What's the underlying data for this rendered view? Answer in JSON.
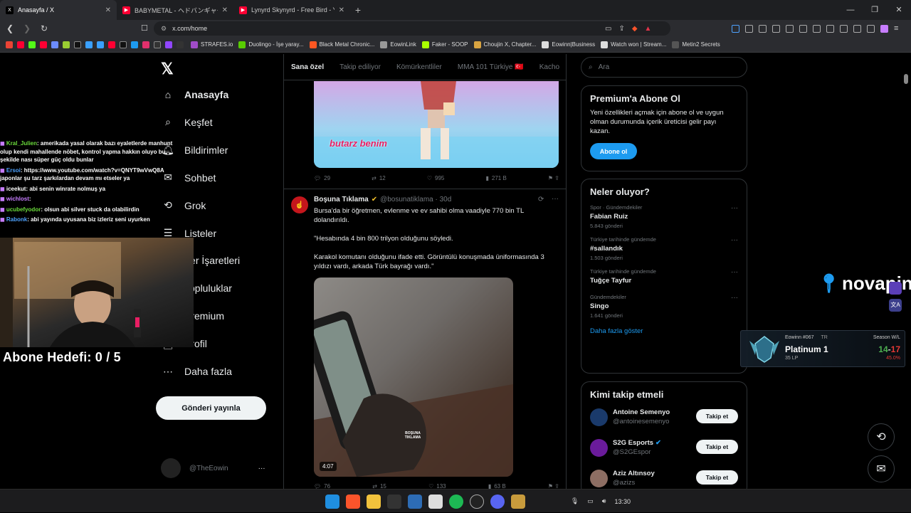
{
  "browser": {
    "tabs": [
      {
        "title": "Anasayfa / X",
        "fav": "X",
        "color": "#000000",
        "active": true
      },
      {
        "title": "BABYMETAL - ヘドバンギャー！！ 15th",
        "fav": "▶",
        "color": "#ff0033",
        "active": false
      },
      {
        "title": "Lynyrd Skynyrd - Free Bird - YouT",
        "fav": "▶",
        "color": "#ff0033",
        "active": false
      }
    ],
    "url": "x.com/home",
    "bookmarks": [
      {
        "label": "STRAFES.io",
        "color": "#a04cc8"
      },
      {
        "label": "Duolingo - İşe yaray...",
        "color": "#58cc02"
      },
      {
        "label": "Black Metal Chronic...",
        "color": "#ff5722"
      },
      {
        "label": "EowinLink",
        "color": "#999999"
      },
      {
        "label": "Faker - SOOP",
        "color": "#aaff00"
      },
      {
        "label": "Choujin X, Chapter...",
        "color": "#d9a441"
      },
      {
        "label": "Eowinn|Business",
        "color": "#dddddd"
      },
      {
        "label": "Watch won | Stream...",
        "color": "#dddddd"
      },
      {
        "label": "Metin2 Secrets",
        "color": "#555555"
      }
    ]
  },
  "nav": {
    "items": [
      {
        "label": "Anasayfa",
        "icon": "home-icon",
        "bold": true
      },
      {
        "label": "Keşfet",
        "icon": "search-icon"
      },
      {
        "label": "Bildirimler",
        "icon": "bell-icon"
      },
      {
        "label": "Sohbet",
        "icon": "mail-icon"
      },
      {
        "label": "Grok",
        "icon": "grok-icon"
      },
      {
        "label": "Listeler",
        "icon": "list-icon"
      },
      {
        "label": "Yer İşaretleri",
        "icon": "bookmark-icon"
      },
      {
        "label": "Topluluklar",
        "icon": "people-icon"
      },
      {
        "label": "Premium",
        "icon": "x-icon"
      },
      {
        "label": "Profil",
        "icon": "user-icon"
      },
      {
        "label": "Daha fazla",
        "icon": "more-icon"
      }
    ],
    "post_label": "Gönderi yayınla",
    "account_handle": "@TheEowin"
  },
  "overlay": {
    "chat": [
      {
        "user": "Kral_Julien",
        "color": "#6bdc3b",
        "text": ": amerikada yasal olarak bazı eyaletlerde manhunt olup kendi mahallende nöbet, kontrol yapma hakkın oluyo bu şekilde nası süper güç oldu bunlar"
      },
      {
        "user": "Ersoi",
        "color": "#4fa3ff",
        "text": ": https://www.youtube.com/watch?v=QNYT9wVwQ8A japonlar şu tarz şarkılardan devam mı etseler ya"
      },
      {
        "user": "iceekut",
        "color": "#ffffff",
        "text": ": abi senin winrate nolmuş ya"
      },
      {
        "user": "wichlost",
        "color": "#c77dff",
        "text": ":"
      },
      {
        "user": "ucubefyodor",
        "color": "#6bdc3b",
        "text": ": olsun abi silver stuck da olabilirdin"
      },
      {
        "user": "Rabonk",
        "color": "#4fa3ff",
        "text": ": abi yayında uyusana biz izleriz seni uyurken"
      }
    ],
    "goal": "Abone Hedefi:  0 / 5",
    "brand": "novapin"
  },
  "timeline": {
    "tabs": [
      "Sana özel",
      "Takip ediliyor",
      "Kömürkentliler",
      "MMA 101 Türkiye 🇹🇷",
      "Kacho"
    ],
    "tweet1_actions": {
      "replies": "29",
      "reposts": "12",
      "likes": "995",
      "views": "271 B"
    },
    "media1_caption": "butarz benim",
    "tweet2": {
      "name": "Boşuna Tıklama",
      "handle": "@bosunatiklama · 30d",
      "text1": "Bursa'da bir öğretmen, evlenme ve ev sahibi olma vaadiyle 770 bin TL dolandırıldı.",
      "text2": "\"Hesabında 4 bin 800 trilyon olduğunu söyledi.",
      "text3": "Karakol komutanı olduğunu ifade etti. Görüntülü konuşmada üniformasında 3 yıldızı vardı, arkada Türk bayrağı vardı.\"",
      "duration": "4:07",
      "watermark": "BOŞUNA TIKLAMA",
      "actions": {
        "replies": "76",
        "reposts": "15",
        "likes": "133",
        "views": "63 B"
      }
    }
  },
  "sidebar": {
    "search_placeholder": "Ara",
    "premium": {
      "title": "Premium'a Abone Ol",
      "text": "Yeni özellikleri açmak için abone ol ve uygun olman durumunda içerik üreticisi gelir payı kazan.",
      "button": "Abone ol"
    },
    "trends_title": "Neler oluyor?",
    "trends": [
      {
        "category": "Spor · Gündemdekiler",
        "name": "Fabian Ruiz",
        "posts": "5.843 gönderi"
      },
      {
        "category": "Türkiye tarihinde gündemde",
        "name": "#sallandık",
        "posts": "1.503 gönderi"
      },
      {
        "category": "Türkiye tarihinde gündemde",
        "name": "Tuğçe Tayfur",
        "posts": ""
      },
      {
        "category": "Gündemdekiler",
        "name": "Singo",
        "posts": "1.641 gönderi"
      }
    ],
    "show_more": "Daha fazla göster",
    "who_title": "Kimi takip etmeli",
    "who": [
      {
        "name": "Antoine Semenyo",
        "handle": "@antoinesemenyo",
        "verified": false,
        "color": "#1a3a6b"
      },
      {
        "name": "S2G Esports",
        "handle": "@S2GEspor",
        "verified": true,
        "color": "#6a1b9a"
      },
      {
        "name": "Aziz Altınsoy",
        "handle": "@azizs",
        "verified": false,
        "color": "#8d6e63"
      }
    ],
    "follow_label": "Takip et"
  },
  "rank": {
    "summoner": "Eowinn #067",
    "region": "TR",
    "tier": "Platinum 1",
    "lp": "35 LP",
    "season_label": "Season W/L",
    "wins": "14",
    "losses": "17",
    "winrate": "45.0%"
  },
  "taskbar": {
    "time": "13:30"
  },
  "colors": {
    "accent": "#1d9bf0",
    "bg": "#000000",
    "border": "#2f3336",
    "muted": "#71767b"
  }
}
